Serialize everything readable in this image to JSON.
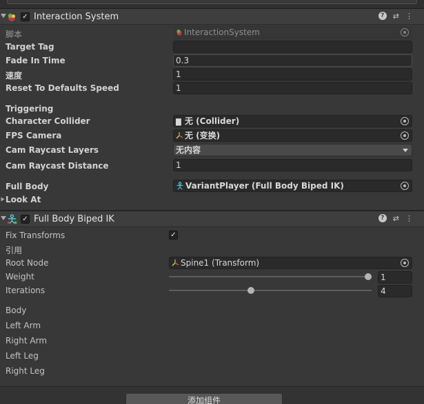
{
  "interaction_system": {
    "title": "Interaction System",
    "enabled": true,
    "script_label": "脚本",
    "script_value": "InteractionSystem",
    "fields": [
      {
        "label": "Target Tag",
        "value": ""
      },
      {
        "label": "Fade In Time",
        "value": "0.3"
      },
      {
        "label": "速度",
        "value": "1"
      },
      {
        "label": "Reset To Defaults Speed",
        "value": "1"
      }
    ],
    "triggering_label": "Triggering",
    "character_collider_label": "Character Collider",
    "character_collider_value": "无 (Collider)",
    "fps_camera_label": "FPS Camera",
    "fps_camera_value": "无 (变换)",
    "cam_raycast_layers_label": "Cam Raycast Layers",
    "cam_raycast_layers_value": "无内容",
    "cam_raycast_distance_label": "Cam Raycast Distance",
    "cam_raycast_distance_value": "1",
    "full_body_label": "Full Body",
    "full_body_value": "VariantPlayer (Full Body Biped IK)",
    "look_at_label": "Look At"
  },
  "full_body_biped_ik": {
    "title": "Full Body Biped IK",
    "enabled": true,
    "fix_transforms_label": "Fix Transforms",
    "fix_transforms_checked": true,
    "references_label": "引用",
    "root_node_label": "Root Node",
    "root_node_value": "Spine1 (Transform)",
    "weight_label": "Weight",
    "weight_value": "1",
    "weight_fraction": 1.0,
    "iterations_label": "Iterations",
    "iterations_value": "4",
    "iterations_fraction": 0.4,
    "sections": [
      "Body",
      "Left Arm",
      "Right Arm",
      "Left Leg",
      "Right Leg"
    ]
  },
  "add_component_label": "添加组件",
  "colors": {
    "background": "#383838",
    "header": "#3e3e3e",
    "field": "#2a2a2a",
    "text": "#d2d2d2"
  }
}
